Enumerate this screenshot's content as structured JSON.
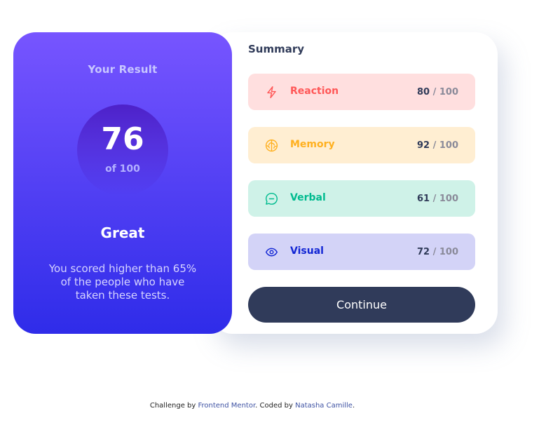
{
  "result": {
    "title": "Your Result",
    "score": "76",
    "out_of": "of 100",
    "rating": "Great",
    "description": "You scored higher than 65% of the people who have taken these tests."
  },
  "summary": {
    "title": "Summary",
    "items": [
      {
        "label": "Reaction",
        "score": "80",
        "max": "/ 100",
        "icon": "lightning-icon",
        "color": "#ff5757",
        "bg": "#ffdfdf"
      },
      {
        "label": "Memory",
        "score": "92",
        "max": "/ 100",
        "icon": "brain-icon",
        "color": "#ffb01f",
        "bg": "#ffeed2"
      },
      {
        "label": "Verbal",
        "score": "61",
        "max": "/ 100",
        "icon": "chat-bubble-icon",
        "color": "#00bb8f",
        "bg": "#cff2e8"
      },
      {
        "label": "Visual",
        "score": "72",
        "max": "/ 100",
        "icon": "eye-icon",
        "color": "#1125d4",
        "bg": "#d3d3f7"
      }
    ],
    "continue_label": "Continue"
  },
  "footer": {
    "prefix": "Challenge by ",
    "link1": "Frontend Mentor",
    "middle": ". Coded by ",
    "link2": "Natasha Camille",
    "suffix": "."
  }
}
